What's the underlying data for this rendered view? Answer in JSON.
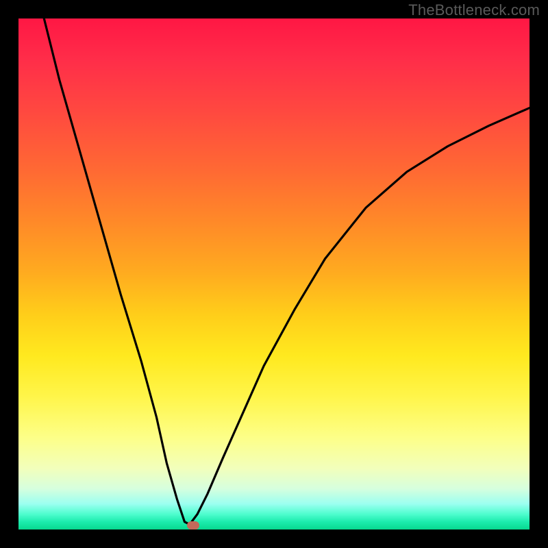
{
  "watermark": "TheBottleneck.com",
  "colors": {
    "frame_background": "#000000",
    "watermark_text": "#5a5a5a",
    "curve_stroke": "#000000",
    "marker_fill": "#c46a5a",
    "gradient_top": "#ff1744",
    "gradient_bottom": "#07d88f"
  },
  "chart_data": {
    "type": "line",
    "title": "",
    "xlabel": "",
    "ylabel": "",
    "xlim": [
      0,
      100
    ],
    "ylim": [
      0,
      100
    ],
    "grid": false,
    "legend": false,
    "series": [
      {
        "name": "bottleneck-curve",
        "x": [
          5,
          8,
          12,
          16,
          20,
          24,
          27,
          29,
          31,
          32.5,
          33.5,
          35,
          37,
          40,
          44,
          48,
          54,
          60,
          68,
          76,
          84,
          92,
          100
        ],
        "values": [
          100,
          88,
          74,
          60,
          46,
          33,
          22,
          13,
          6,
          1.5,
          1,
          3,
          7,
          14,
          23,
          32,
          43,
          53,
          63,
          70,
          75,
          79,
          82.5
        ]
      }
    ],
    "marker": {
      "name": "selected-point",
      "x": 34.2,
      "y": 0.8
    },
    "y_axis_direction_note": "y=0 at bottom (green), y=100 at top (red); values represent bottleneck %"
  }
}
